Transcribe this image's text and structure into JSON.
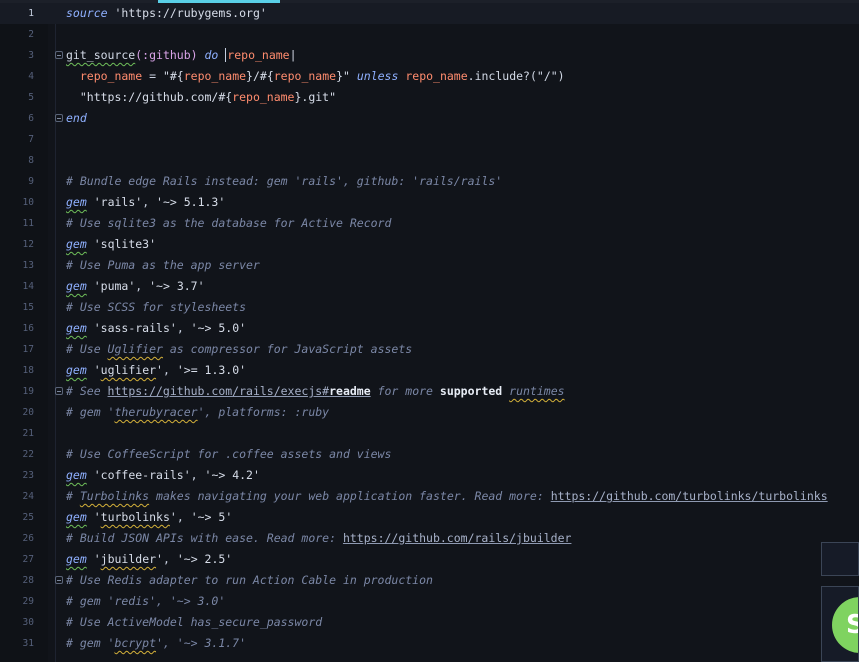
{
  "editor": {
    "lines": [
      {
        "n": "1",
        "tokens": [
          {
            "t": "source",
            "c": "kw"
          },
          {
            "t": " "
          },
          {
            "t": "'https://rubygems.org'",
            "c": "str"
          }
        ]
      },
      {
        "n": "2",
        "tokens": []
      },
      {
        "n": "3",
        "fold": true,
        "tokens": [
          {
            "t": "git_source",
            "c": "plain",
            "spell": "g"
          },
          {
            "t": "(:github)",
            "c": "sym"
          },
          {
            "t": " "
          },
          {
            "t": "do",
            "c": "kw"
          },
          {
            "t": " "
          },
          {
            "cursor": true
          },
          {
            "t": "repo_name",
            "c": "var"
          },
          {
            "t": "|",
            "c": "plain"
          }
        ]
      },
      {
        "n": "4",
        "tokens": [
          {
            "t": "  repo_name",
            "c": "var"
          },
          {
            "t": " = "
          },
          {
            "t": "\"#{",
            "c": "str"
          },
          {
            "t": "repo_name",
            "c": "var"
          },
          {
            "t": "}/#{",
            "c": "str"
          },
          {
            "t": "repo_name",
            "c": "var"
          },
          {
            "t": "}\"",
            "c": "str"
          },
          {
            "t": " "
          },
          {
            "t": "unless",
            "c": "kw"
          },
          {
            "t": " "
          },
          {
            "t": "repo_name",
            "c": "var"
          },
          {
            "t": ".include?(\"/\")",
            "c": "plain"
          }
        ]
      },
      {
        "n": "5",
        "tokens": [
          {
            "t": "  \"https://github.com/#{",
            "c": "str"
          },
          {
            "t": "repo_name",
            "c": "var"
          },
          {
            "t": "}.git\"",
            "c": "str"
          }
        ]
      },
      {
        "n": "6",
        "fold": true,
        "tokens": [
          {
            "t": "end",
            "c": "kw"
          }
        ]
      },
      {
        "n": "7",
        "tokens": []
      },
      {
        "n": "8",
        "tokens": []
      },
      {
        "n": "9",
        "tokens": [
          {
            "t": "# Bundle edge Rails instead: gem 'rails', github: 'rails/rails'",
            "c": "cmt"
          }
        ]
      },
      {
        "n": "10",
        "tokens": [
          {
            "t": "gem",
            "c": "kw",
            "spell": "g"
          },
          {
            "t": " "
          },
          {
            "t": "'rails'",
            "c": "str"
          },
          {
            "t": ", "
          },
          {
            "t": "'~> 5.1.3'",
            "c": "str"
          }
        ]
      },
      {
        "n": "11",
        "tokens": [
          {
            "t": "# Use sqlite3 as the database for Active Record",
            "c": "cmt"
          }
        ]
      },
      {
        "n": "12",
        "tokens": [
          {
            "t": "gem",
            "c": "kw",
            "spell": "g"
          },
          {
            "t": " "
          },
          {
            "t": "'sqlite3'",
            "c": "str"
          }
        ]
      },
      {
        "n": "13",
        "tokens": [
          {
            "t": "# Use Puma as the app server",
            "c": "cmt"
          }
        ]
      },
      {
        "n": "14",
        "tokens": [
          {
            "t": "gem",
            "c": "kw",
            "spell": "g"
          },
          {
            "t": " "
          },
          {
            "t": "'puma'",
            "c": "str"
          },
          {
            "t": ", "
          },
          {
            "t": "'~> 3.7'",
            "c": "str"
          }
        ]
      },
      {
        "n": "15",
        "tokens": [
          {
            "t": "# Use SCSS for stylesheets",
            "c": "cmt"
          }
        ]
      },
      {
        "n": "16",
        "tokens": [
          {
            "t": "gem",
            "c": "kw",
            "spell": "g"
          },
          {
            "t": " "
          },
          {
            "t": "'sass-rails'",
            "c": "str"
          },
          {
            "t": ", "
          },
          {
            "t": "'~> 5.0'",
            "c": "str"
          }
        ]
      },
      {
        "n": "17",
        "tokens": [
          {
            "t": "# Use ",
            "c": "cmt"
          },
          {
            "t": "Uglifier",
            "c": "cmt",
            "spell": "y"
          },
          {
            "t": " as compressor for JavaScript assets",
            "c": "cmt"
          }
        ]
      },
      {
        "n": "18",
        "tokens": [
          {
            "t": "gem",
            "c": "kw",
            "spell": "g"
          },
          {
            "t": " "
          },
          {
            "t": "'",
            "c": "str"
          },
          {
            "t": "uglifier",
            "c": "str",
            "spell": "y"
          },
          {
            "t": "'",
            "c": "str"
          },
          {
            "t": ", "
          },
          {
            "t": "'>= 1.3.0'",
            "c": "str"
          }
        ]
      },
      {
        "n": "19",
        "fold": true,
        "tokens": [
          {
            "t": "# See ",
            "c": "cmt"
          },
          {
            "t": "https://github.com/rails/execjs#",
            "c": "link"
          },
          {
            "t": "readme",
            "c": "bold",
            "link": true
          },
          {
            "t": " for more ",
            "c": "cmt"
          },
          {
            "t": "supported",
            "c": "bold"
          },
          {
            "t": " ",
            "c": "cmt"
          },
          {
            "t": "runtimes",
            "c": "cmt",
            "spell": "y"
          }
        ]
      },
      {
        "n": "20",
        "tokens": [
          {
            "t": "# gem '",
            "c": "cmt"
          },
          {
            "t": "therubyracer",
            "c": "cmt",
            "spell": "y"
          },
          {
            "t": "', platforms: :ruby",
            "c": "cmt"
          }
        ]
      },
      {
        "n": "21",
        "tokens": []
      },
      {
        "n": "22",
        "tokens": [
          {
            "t": "# Use CoffeeScript for .coffee assets and views",
            "c": "cmt"
          }
        ]
      },
      {
        "n": "23",
        "tokens": [
          {
            "t": "gem",
            "c": "kw",
            "spell": "g"
          },
          {
            "t": " "
          },
          {
            "t": "'coffee-rails'",
            "c": "str"
          },
          {
            "t": ", "
          },
          {
            "t": "'~> 4.2'",
            "c": "str"
          }
        ]
      },
      {
        "n": "24",
        "tokens": [
          {
            "t": "# ",
            "c": "cmt"
          },
          {
            "t": "Turbolinks",
            "c": "cmt",
            "spell": "y"
          },
          {
            "t": " makes navigating your web application faster. Read more: ",
            "c": "cmt"
          },
          {
            "t": "https://github.com/turbolinks/turbolinks",
            "c": "link"
          }
        ]
      },
      {
        "n": "25",
        "tokens": [
          {
            "t": "gem",
            "c": "kw",
            "spell": "g"
          },
          {
            "t": " "
          },
          {
            "t": "'",
            "c": "str"
          },
          {
            "t": "turbolinks",
            "c": "str",
            "spell": "y"
          },
          {
            "t": "'",
            "c": "str"
          },
          {
            "t": ", "
          },
          {
            "t": "'~> 5'",
            "c": "str"
          }
        ]
      },
      {
        "n": "26",
        "tokens": [
          {
            "t": "# Build JSON APIs with ease. Read more: ",
            "c": "cmt"
          },
          {
            "t": "https://github.com/rails/jbuilder",
            "c": "link"
          }
        ]
      },
      {
        "n": "27",
        "tokens": [
          {
            "t": "gem",
            "c": "kw",
            "spell": "g"
          },
          {
            "t": " "
          },
          {
            "t": "'",
            "c": "str"
          },
          {
            "t": "jbuilder",
            "c": "str",
            "spell": "y"
          },
          {
            "t": "'",
            "c": "str"
          },
          {
            "t": ", "
          },
          {
            "t": "'~> 2.5'",
            "c": "str"
          }
        ]
      },
      {
        "n": "28",
        "fold": true,
        "tokens": [
          {
            "t": "# Use Redis adapter to run Action Cable in production",
            "c": "cmt"
          }
        ]
      },
      {
        "n": "29",
        "tokens": [
          {
            "t": "# gem 'redis', '~> 3.0'",
            "c": "cmt"
          }
        ]
      },
      {
        "n": "30",
        "tokens": [
          {
            "t": "# Use ActiveModel has_secure_password",
            "c": "cmt"
          }
        ]
      },
      {
        "n": "31",
        "tokens": [
          {
            "t": "# gem '",
            "c": "cmt"
          },
          {
            "t": "bcrypt",
            "c": "cmt",
            "spell": "y"
          },
          {
            "t": "', '~> 3.1.7'",
            "c": "cmt"
          }
        ]
      }
    ]
  },
  "overlay": {
    "avatar_letter": "S"
  },
  "colors": {
    "background": "#11141a",
    "keyword": "#8fb0ff",
    "variable": "#ff8c6e",
    "comment": "#7b87a6",
    "tab_indicator": "#5ad0e8",
    "avatar": "#7fd360"
  }
}
